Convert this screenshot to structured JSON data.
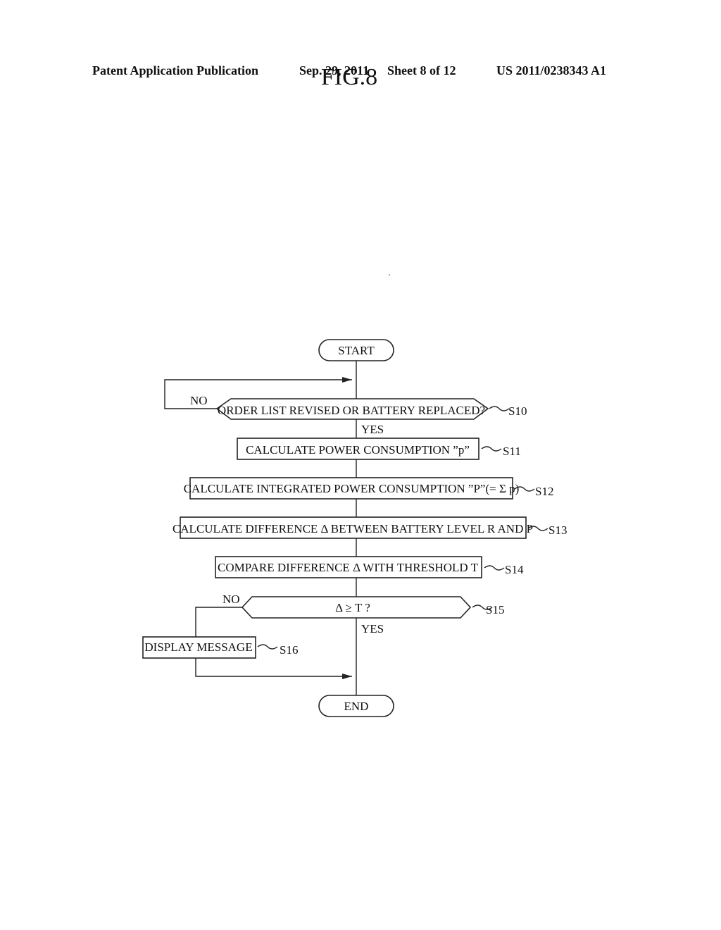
{
  "header": {
    "publication": "Patent Application Publication",
    "date": "Sep. 29, 2011",
    "sheet": "Sheet 8 of 12",
    "patent_number": "US 2011/0238343 A1"
  },
  "figure": {
    "title": "FIG.8"
  },
  "flowchart": {
    "start": "START",
    "end": "END",
    "steps": {
      "s10": {
        "id": "S10",
        "text": "ORDER LIST REVISED OR BATTERY REPLACED?",
        "no": "NO",
        "yes": "YES"
      },
      "s11": {
        "id": "S11",
        "text": "CALCULATE POWER CONSUMPTION ”p”"
      },
      "s12": {
        "id": "S12",
        "text": "CALCULATE INTEGRATED POWER CONSUMPTION ”P”(= Σ p)"
      },
      "s13": {
        "id": "S13",
        "text": "CALCULATE DIFFERENCE Δ BETWEEN BATTERY LEVEL R AND P"
      },
      "s14": {
        "id": "S14",
        "text": "COMPARE DIFFERENCE Δ WITH THRESHOLD T"
      },
      "s15": {
        "id": "S15",
        "text": "Δ ≥ T ?",
        "no": "NO",
        "yes": "YES"
      },
      "s16": {
        "id": "S16",
        "text": "DISPLAY MESSAGE"
      }
    }
  }
}
